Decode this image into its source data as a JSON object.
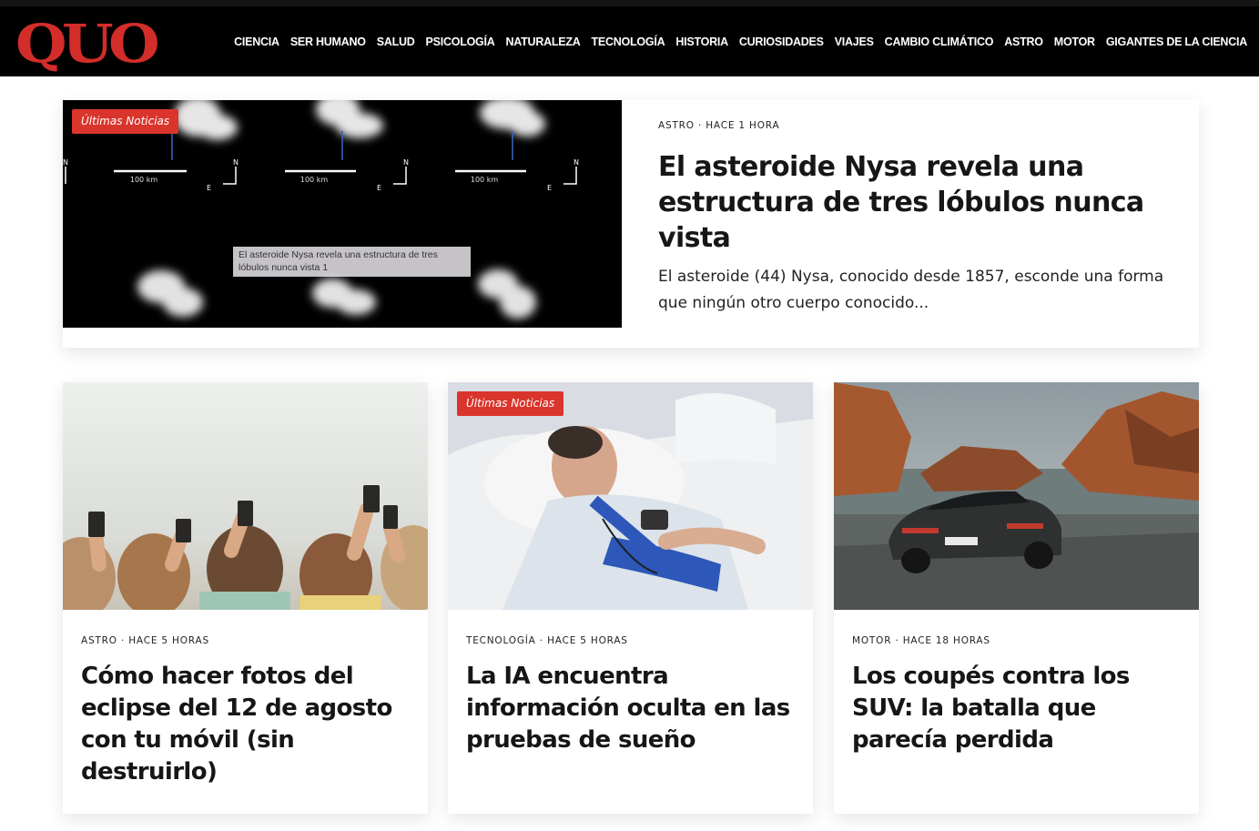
{
  "header": {
    "logo_text": "QUO",
    "nav": [
      "CIENCIA",
      "SER HUMANO",
      "SALUD",
      "PSICOLOGÍA",
      "NATURALEZA",
      "TECNOLOGÍA",
      "HISTORIA",
      "CURIOSIDADES",
      "VIAJES",
      "CAMBIO CLIMÁTICO",
      "ASTRO",
      "MOTOR",
      "GIGANTES DE LA CIENCIA"
    ]
  },
  "colors": {
    "brand": "#d32d2a",
    "badge": "#d9352c",
    "header_bg": "#000000"
  },
  "hero": {
    "badge": "Últimas Noticias",
    "meta": "ASTRO · HACE 1 HORA",
    "title": "El asteroide Nysa revela una estructura de tres lóbulos nunca vista",
    "excerpt": "El asteroide (44) Nysa, conocido desde 1857, esconde una forma que ningún otro cuerpo conocido...",
    "caption": "El asteroide Nysa revela una estructura de tres lóbulos nunca vista 1",
    "scale_labels": [
      "100 km",
      "100 km",
      "100 km"
    ],
    "compass_n": "N",
    "compass_e": "E"
  },
  "cards": [
    {
      "badge": "",
      "meta": "ASTRO · HACE 5 HORAS",
      "title": "Cómo hacer fotos del eclipse del 12 de agosto con tu móvil (sin destruirlo)"
    },
    {
      "badge": "Últimas Noticias",
      "meta": "TECNOLOGÍA · HACE 5 HORAS",
      "title": "La IA encuentra información oculta en las pruebas de sueño"
    },
    {
      "badge": "",
      "meta": "MOTOR · HACE 18 HORAS",
      "title": "Los coupés contra los SUV: la batalla que parecía perdida"
    }
  ]
}
